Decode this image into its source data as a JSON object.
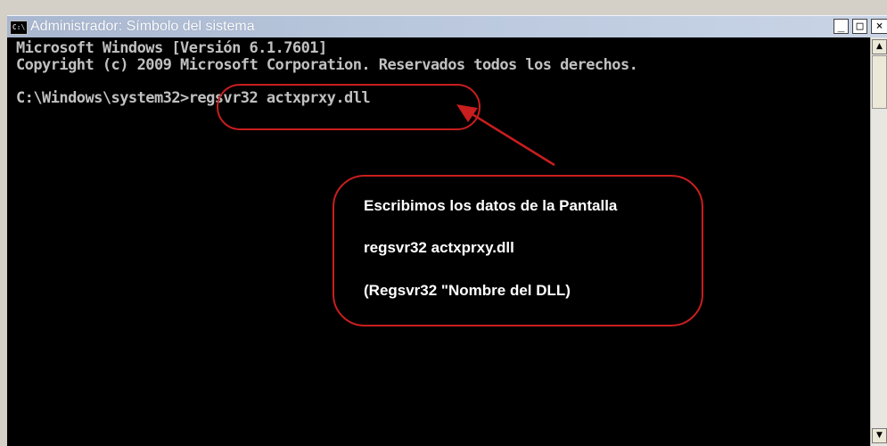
{
  "window": {
    "title": "Administrador: Símbolo del sistema",
    "icon_text": "C:\\",
    "minimize_label": "_",
    "maximize_label": "□",
    "close_label": "×"
  },
  "console": {
    "lines": [
      "Microsoft Windows [Versión 6.1.7601]",
      "Copyright (c) 2009 Microsoft Corporation. Reservados todos los derechos.",
      "",
      "C:\\Windows\\system32>regsvr32 actxprxy.dll"
    ]
  },
  "callout": {
    "line1": "Escribimos los datos de la Pantalla",
    "line2": "regsvr32 actxprxy.dll",
    "line3": "(Regsvr32  \"Nombre del DLL)"
  },
  "scrollbar": {
    "up_arrow": "▲",
    "down_arrow": "▼"
  },
  "colors": {
    "console_bg": "#000000",
    "console_text": "#c0c0c0",
    "annotation_red": "#c81e1e",
    "callout_text": "#ffffff"
  }
}
